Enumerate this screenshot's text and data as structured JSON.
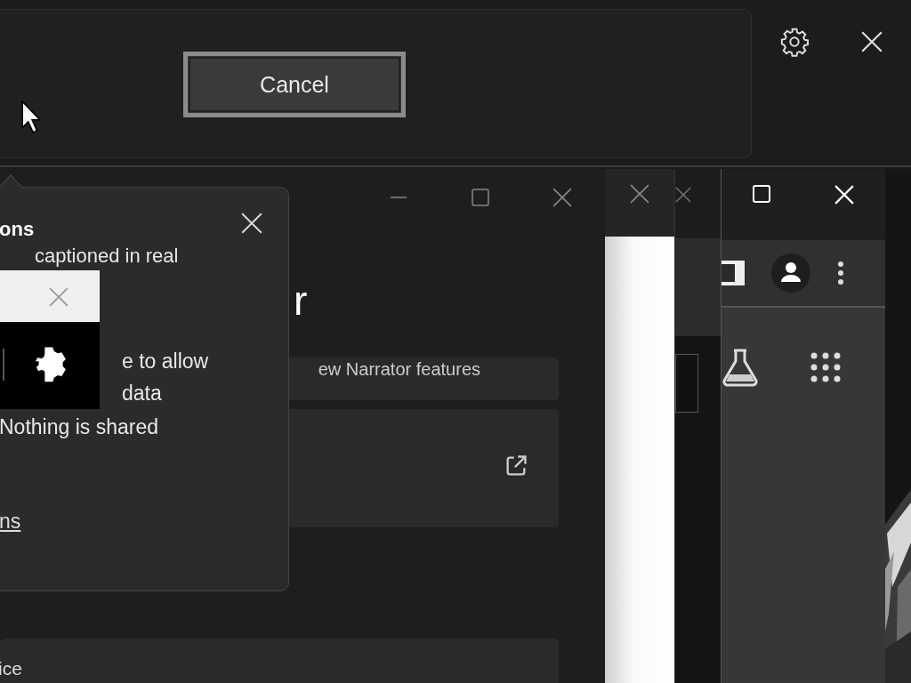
{
  "top_dialog": {
    "button": {
      "label": "Cancel"
    }
  },
  "narrator_window": {
    "title": "r",
    "cards": [
      {
        "kind": "text",
        "text": "ew Narrator features"
      },
      {
        "kind": "external"
      },
      {
        "kind": "text",
        "text": "ice"
      }
    ]
  },
  "captions_popup": {
    "title": "ons",
    "lines": [
      "captioned in real",
      "e to allow",
      "data",
      "Nothing is shared"
    ],
    "link": "ns"
  }
}
